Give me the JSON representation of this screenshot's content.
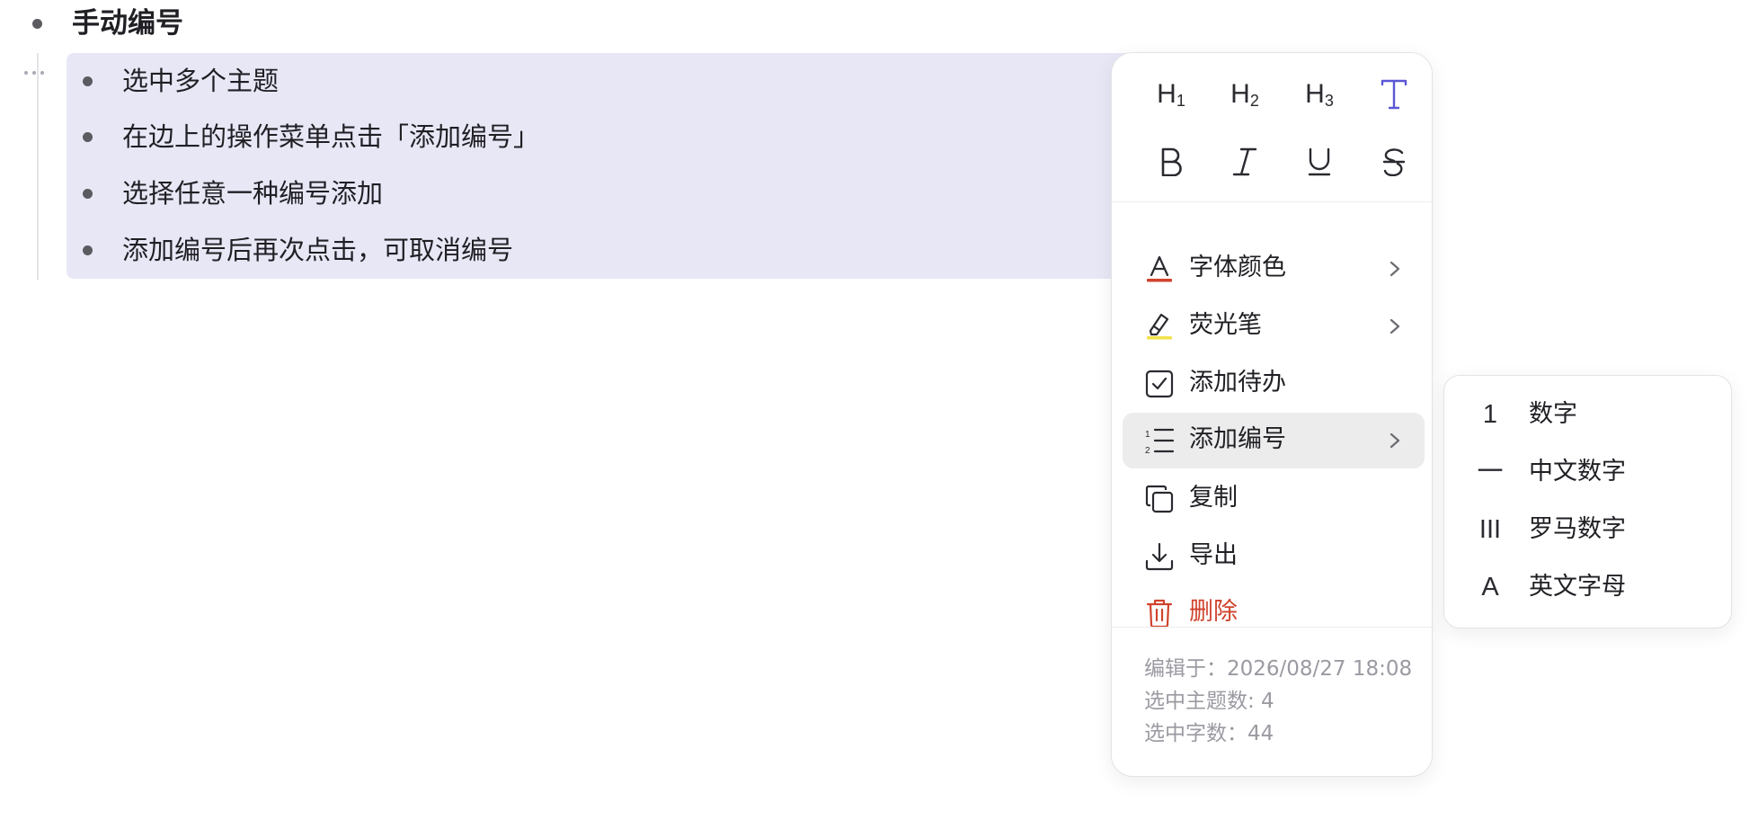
{
  "outline": {
    "root_title": "手动编号",
    "children": [
      "选中多个主题",
      "在边上的操作菜单点击「添加编号」",
      "选择任意一种编号添加",
      "添加编号后再次点击，可取消编号"
    ]
  },
  "menu": {
    "format_buttons": [
      {
        "icon": "heading-1-icon",
        "text": "H",
        "sub": "1"
      },
      {
        "icon": "heading-2-icon",
        "text": "H",
        "sub": "2"
      },
      {
        "icon": "heading-3-icon",
        "text": "H",
        "sub": "3"
      },
      {
        "icon": "text-body-icon",
        "active_color": "#5b57d6"
      },
      {
        "icon": "bold-icon"
      },
      {
        "icon": "italic-icon"
      },
      {
        "icon": "underline-icon"
      },
      {
        "icon": "strikethrough-icon"
      }
    ],
    "items": [
      {
        "label": "字体颜色",
        "icon": "font-color-icon",
        "has_submenu": true,
        "accent": "#d0432c"
      },
      {
        "label": "荧光笔",
        "icon": "highlighter-icon",
        "has_submenu": true,
        "accent": "#f2e24a"
      },
      {
        "label": "添加待办",
        "icon": "checkbox-icon",
        "has_submenu": false
      },
      {
        "label": "添加编号",
        "icon": "numbered-list-icon",
        "has_submenu": true,
        "hovered": true
      },
      {
        "label": "复制",
        "icon": "copy-icon",
        "has_submenu": false
      },
      {
        "label": "导出",
        "icon": "download-icon",
        "has_submenu": false
      },
      {
        "label": "删除",
        "icon": "trash-icon",
        "has_submenu": false,
        "danger_color": "#d0432c"
      }
    ],
    "meta": {
      "edited": "编辑于：2026/08/27 18:08",
      "selected_topics": "选中主题数: 4",
      "selected_chars": "选中字数：44"
    }
  },
  "numbering_submenu": {
    "items": [
      {
        "glyph": "1",
        "label": "数字"
      },
      {
        "glyph": "一",
        "label": "中文数字"
      },
      {
        "glyph": "III",
        "label": "罗马数字"
      },
      {
        "glyph": "A",
        "label": "英文字母"
      }
    ]
  },
  "colors": {
    "selection": "#e8e7f6",
    "accent": "#5b57d6",
    "danger": "#d0432c",
    "hover": "#ececed"
  }
}
